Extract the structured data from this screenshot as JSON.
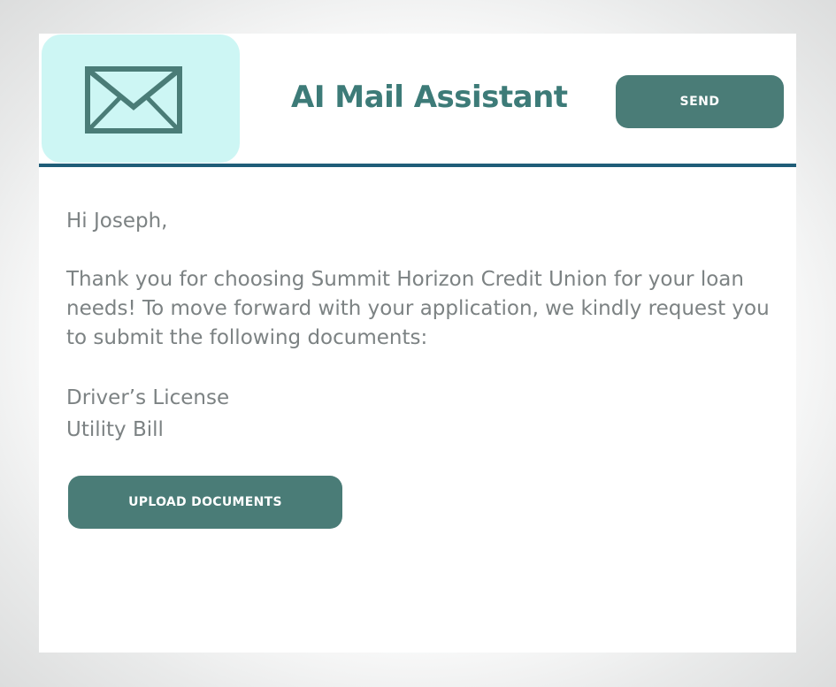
{
  "header": {
    "icon": "envelope-icon",
    "title": "AI Mail Assistant",
    "send_label": "SEND"
  },
  "email": {
    "greeting": "Hi Joseph,",
    "paragraph": "Thank you for choosing Summit Horizon Credit Union for your loan needs! To move forward with your application, we kindly request you to submit the following documents:",
    "documents": [
      "Driver’s License",
      "Utility Bill"
    ],
    "upload_label": "UPLOAD DOCUMENTS"
  },
  "colors": {
    "accent": "#4a7c77",
    "title": "#3d7b78",
    "icon_tile": "#cdf6f4",
    "divider": "#1f5d78",
    "body_text": "#7c8283"
  }
}
